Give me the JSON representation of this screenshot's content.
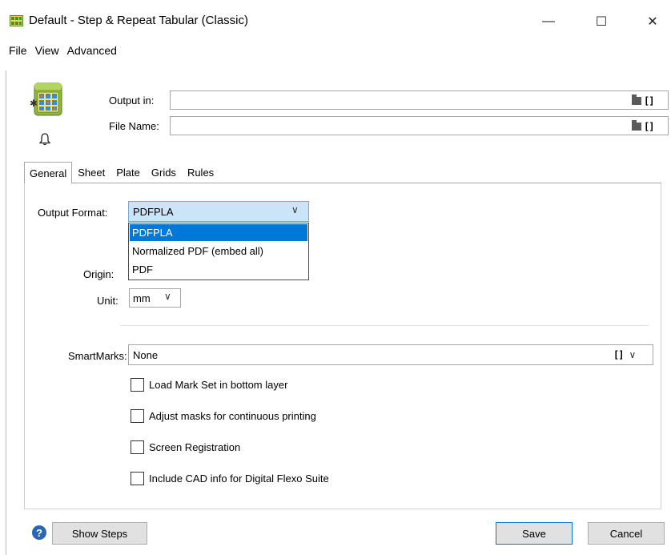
{
  "window": {
    "title": "Default - Step & Repeat Tabular (Classic)",
    "minimize_glyph": "—",
    "maximize_glyph": "☐",
    "close_glyph": "✕"
  },
  "menu": [
    "File",
    "View",
    "Advanced"
  ],
  "header": {
    "output_in_label": "Output in:",
    "output_in_value": "",
    "file_name_label": "File Name:",
    "file_name_value": "",
    "bracket_glyph": "[]"
  },
  "tabs": [
    {
      "label": "General",
      "active": true
    },
    {
      "label": "Sheet",
      "active": false
    },
    {
      "label": "Plate",
      "active": false
    },
    {
      "label": "Grids",
      "active": false
    },
    {
      "label": "Rules",
      "active": false
    }
  ],
  "general": {
    "output_format_label": "Output Format:",
    "output_format_value": "PDFPLA",
    "output_format_options": [
      "PDFPLA",
      "Normalized PDF (embed all)",
      "PDF"
    ],
    "origin_label": "Origin:",
    "unit_label": "Unit:",
    "unit_value": "mm",
    "smartmarks_label": "SmartMarks:",
    "smartmarks_value": "None",
    "checkboxes": [
      {
        "label": "Load Mark Set in bottom layer",
        "checked": false
      },
      {
        "label": "Adjust masks for continuous printing",
        "checked": false
      },
      {
        "label": "Screen Registration",
        "checked": false
      },
      {
        "label": "Include CAD info for Digital Flexo Suite",
        "checked": false
      }
    ],
    "chevron_glyph": "∨"
  },
  "footer": {
    "help_glyph": "?",
    "show_steps_label": "Show Steps",
    "save_label": "Save",
    "cancel_label": "Cancel"
  },
  "colors": {
    "accent": "#0078d7",
    "select_bg": "#cce4f7",
    "help_icon": "#2a66b3"
  },
  "icons": {
    "app": "step-repeat-app-icon",
    "tool": "step-repeat-tool-icon",
    "bell": "bell-icon",
    "folder": "folder-icon",
    "help": "help-icon"
  }
}
